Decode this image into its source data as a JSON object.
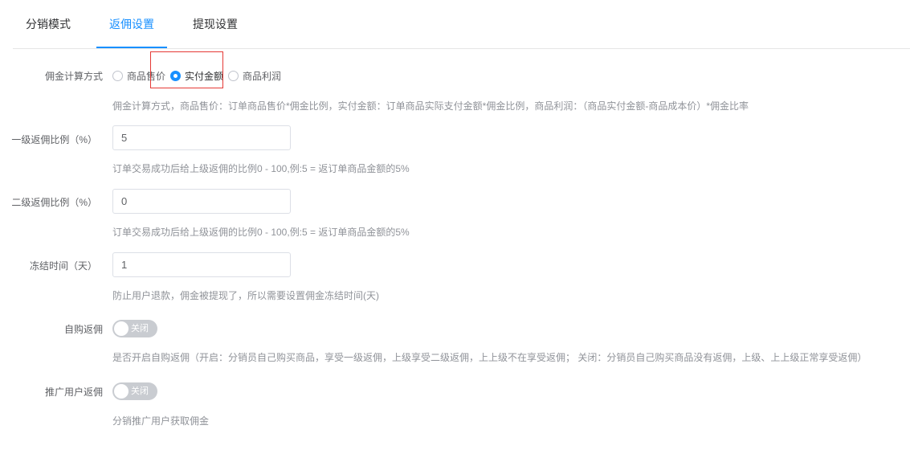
{
  "tabs": [
    {
      "label": "分销模式"
    },
    {
      "label": "返佣设置"
    },
    {
      "label": "提现设置"
    }
  ],
  "active_tab": "返佣设置",
  "accent_color": "#1890ff",
  "highlight_color": "#e53935",
  "commission_method": {
    "label": "佣金计算方式",
    "options": [
      {
        "label": "商品售价",
        "checked": false
      },
      {
        "label": "实付金额",
        "checked": true
      },
      {
        "label": "商品利润",
        "checked": false
      }
    ],
    "hint": "佣金计算方式，商品售价：订单商品售价*佣金比例，实付金额：订单商品实际支付金额*佣金比例，商品利润：（商品实付金额-商品成本价）*佣金比率"
  },
  "level1": {
    "label": "一级返佣比例（%）",
    "value": "5",
    "hint": "订单交易成功后给上级返佣的比例0 - 100,例:5 = 返订单商品金额的5%"
  },
  "level2": {
    "label": "二级返佣比例（%）",
    "value": "0",
    "hint": "订单交易成功后给上级返佣的比例0 - 100,例:5 = 返订单商品金额的5%"
  },
  "freeze": {
    "label": "冻结时间（天）",
    "value": "1",
    "hint": "防止用户退款，佣金被提现了，所以需要设置佣金冻结时间(天)"
  },
  "self_purchase": {
    "label": "自购返佣",
    "switch_text": "关闭",
    "enabled": false,
    "hint": "是否开启自购返佣（开启：分销员自己购买商品，享受一级返佣，上级享受二级返佣，上上级不在享受返佣； 关闭：分销员自己购买商品没有返佣，上级、上上级正常享受返佣）"
  },
  "promote": {
    "label": "推广用户返佣",
    "switch_text": "关闭",
    "enabled": false,
    "hint": "分销推广用户获取佣金"
  }
}
